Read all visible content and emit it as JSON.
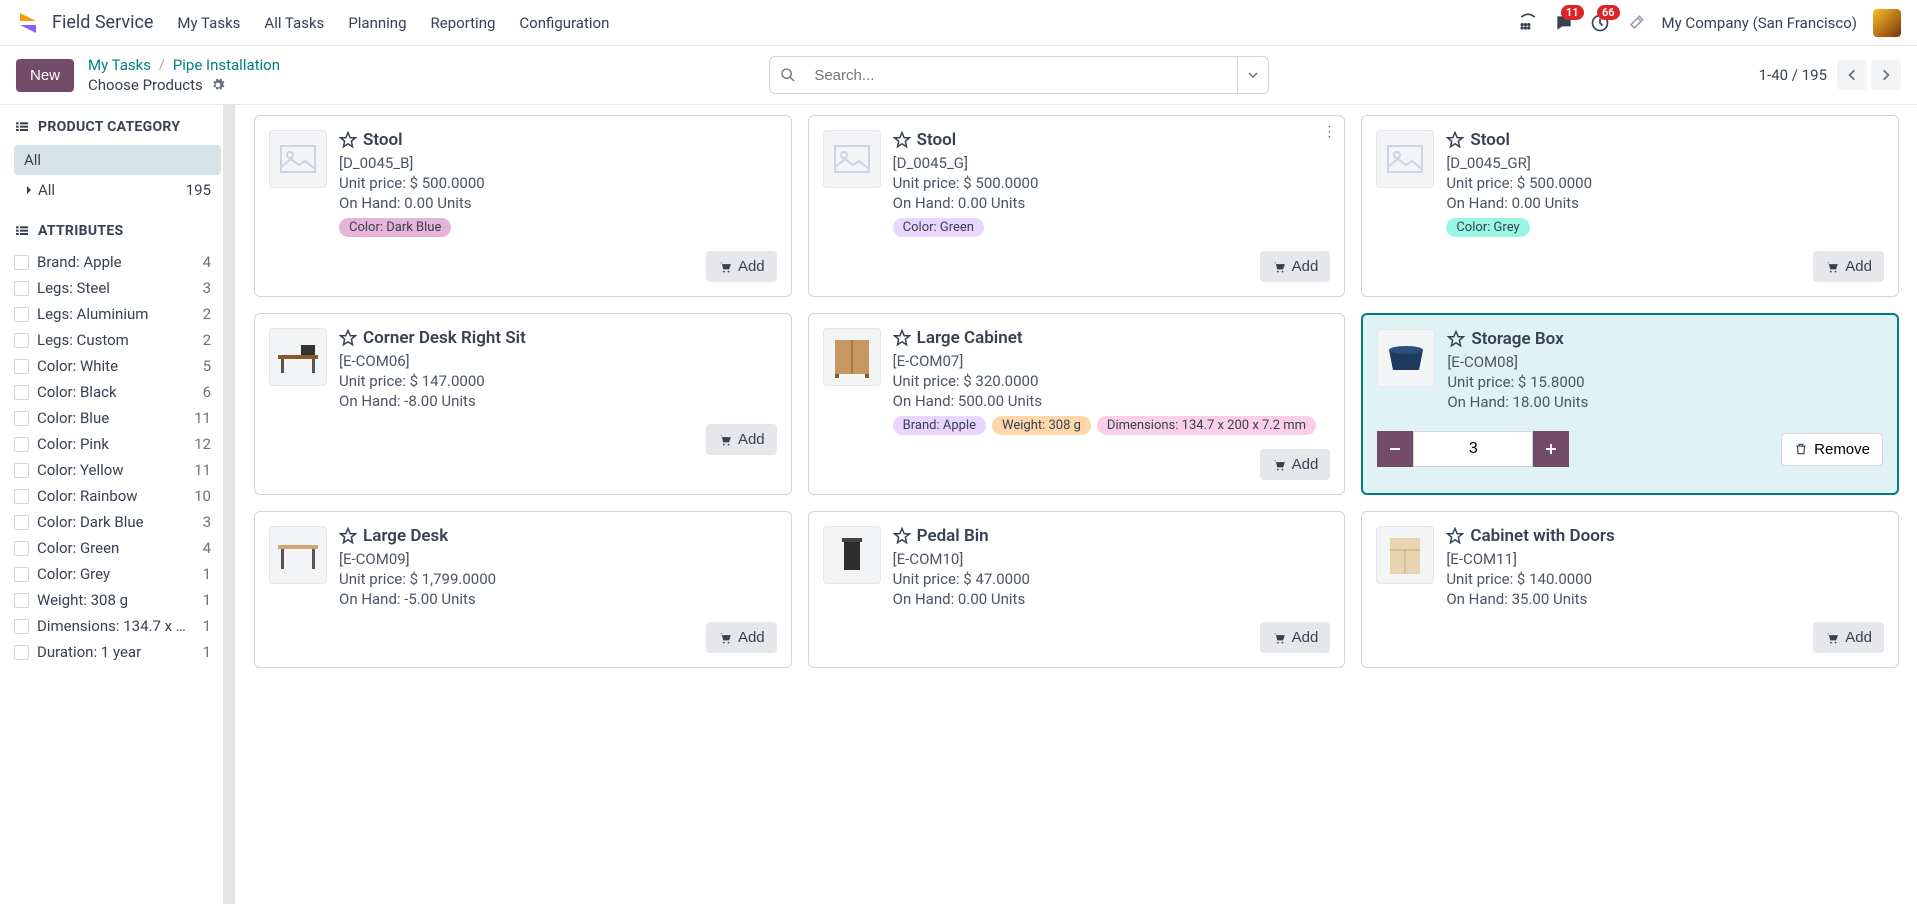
{
  "app": "Field Service",
  "nav": [
    "My Tasks",
    "All Tasks",
    "Planning",
    "Reporting",
    "Configuration"
  ],
  "badges": {
    "chat": "11",
    "clock": "66"
  },
  "company": "My Company (San Francisco)",
  "newLabel": "New",
  "breadcrumb": {
    "a": "My Tasks",
    "b": "Pipe Installation",
    "sub": "Choose Products"
  },
  "searchPlaceholder": "Search...",
  "pager": "1-40 / 195",
  "sidebar": {
    "catHeader": "PRODUCT CATEGORY",
    "catAll": "All",
    "catAllRow": {
      "label": "All",
      "count": "195"
    },
    "attrHeader": "ATTRIBUTES",
    "attrs": [
      {
        "label": "Brand: Apple",
        "count": "4"
      },
      {
        "label": "Legs: Steel",
        "count": "3"
      },
      {
        "label": "Legs: Aluminium",
        "count": "2"
      },
      {
        "label": "Legs: Custom",
        "count": "2"
      },
      {
        "label": "Color: White",
        "count": "5"
      },
      {
        "label": "Color: Black",
        "count": "6"
      },
      {
        "label": "Color: Blue",
        "count": "11"
      },
      {
        "label": "Color: Pink",
        "count": "12"
      },
      {
        "label": "Color: Yellow",
        "count": "11"
      },
      {
        "label": "Color: Rainbow",
        "count": "10"
      },
      {
        "label": "Color: Dark Blue",
        "count": "3"
      },
      {
        "label": "Color: Green",
        "count": "4"
      },
      {
        "label": "Color: Grey",
        "count": "1"
      },
      {
        "label": "Weight: 308 g",
        "count": "1"
      },
      {
        "label": "Dimensions: 134.7 x ...",
        "count": "1"
      },
      {
        "label": "Duration: 1 year",
        "count": "1"
      }
    ]
  },
  "addLabel": "Add",
  "removeLabel": "Remove",
  "products": [
    {
      "name": "Stool",
      "sku": "[D_0045_B]",
      "price": "Unit price: $ 500.0000",
      "onhand": "On Hand: 0.00 Units",
      "tags": [
        {
          "t": "Color: Dark Blue",
          "bg": "#e6b3d9",
          "fg": "#374151"
        }
      ],
      "thumb": "placeholder"
    },
    {
      "name": "Stool",
      "sku": "[D_0045_G]",
      "price": "Unit price: $ 500.0000",
      "onhand": "On Hand: 0.00 Units",
      "tags": [
        {
          "t": "Color: Green",
          "bg": "#e9d5ff",
          "fg": "#374151"
        }
      ],
      "thumb": "placeholder",
      "kebab": true
    },
    {
      "name": "Stool",
      "sku": "[D_0045_GR]",
      "price": "Unit price: $ 500.0000",
      "onhand": "On Hand: 0.00 Units",
      "tags": [
        {
          "t": "Color: Grey",
          "bg": "#99f6e4",
          "fg": "#374151"
        }
      ],
      "thumb": "placeholder"
    },
    {
      "name": "Corner Desk Right Sit",
      "sku": "[E-COM06]",
      "price": "Unit price: $ 147.0000",
      "onhand": "On Hand: -8.00 Units",
      "tags": [],
      "thumb": "desk"
    },
    {
      "name": "Large Cabinet",
      "sku": "[E-COM07]",
      "price": "Unit price: $ 320.0000",
      "onhand": "On Hand: 500.00 Units",
      "tags": [
        {
          "t": "Brand: Apple",
          "bg": "#e9d5ff",
          "fg": "#374151"
        },
        {
          "t": "Weight: 308 g",
          "bg": "#fed7aa",
          "fg": "#374151"
        },
        {
          "t": "Dimensions: 134.7 x 200 x 7.2 mm",
          "bg": "#fbcfe8",
          "fg": "#374151"
        }
      ],
      "thumb": "cabinet"
    },
    {
      "name": "Storage Box",
      "sku": "[E-COM08]",
      "price": "Unit price: $ 15.8000",
      "onhand": "On Hand: 18.00 Units",
      "tags": [],
      "thumb": "box",
      "selected": true,
      "qty": "3"
    },
    {
      "name": "Large Desk",
      "sku": "[E-COM09]",
      "price": "Unit price: $ 1,799.0000",
      "onhand": "On Hand: -5.00 Units",
      "tags": [],
      "thumb": "largedesk"
    },
    {
      "name": "Pedal Bin",
      "sku": "[E-COM10]",
      "price": "Unit price: $ 47.0000",
      "onhand": "On Hand: 0.00 Units",
      "tags": [],
      "thumb": "bin"
    },
    {
      "name": "Cabinet with Doors",
      "sku": "[E-COM11]",
      "price": "Unit price: $ 140.0000",
      "onhand": "On Hand: 35.00 Units",
      "tags": [],
      "thumb": "cab2"
    }
  ]
}
